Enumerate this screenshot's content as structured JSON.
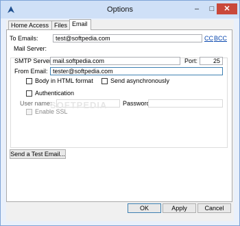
{
  "window": {
    "title": "Options"
  },
  "titlebar_buttons": {
    "minimize": "–",
    "maximize": "□",
    "close": "✕"
  },
  "tabs": [
    {
      "label": "Home Access"
    },
    {
      "label": "Files"
    },
    {
      "label": "Email"
    }
  ],
  "email": {
    "to_label": "To Emails:",
    "to_value": "test@softpedia.com",
    "cc_link": "CC",
    "bcc_link": "BCC",
    "mail_server_label": "Mail Server:",
    "smtp_label": "SMTP Server:",
    "smtp_value": "mail.softpedia.com",
    "port_label": "Port:",
    "port_value": "25",
    "from_label": "From Email:",
    "from_value": "tester@softpedia.com",
    "html_label": "Body in HTML format",
    "async_label": "Send asynchronously",
    "auth_label": "Authentication",
    "user_label": "User name:",
    "password_label": "Password:",
    "ssl_label": "Enable SSL",
    "test_button": "Send a Test Email..."
  },
  "footer": {
    "ok": "OK",
    "apply": "Apply",
    "cancel": "Cancel"
  },
  "watermark": "SOFTPEDIA",
  "colors": {
    "accent": "#3c7fb1",
    "close": "#c9483b",
    "link": "#0645ad"
  }
}
